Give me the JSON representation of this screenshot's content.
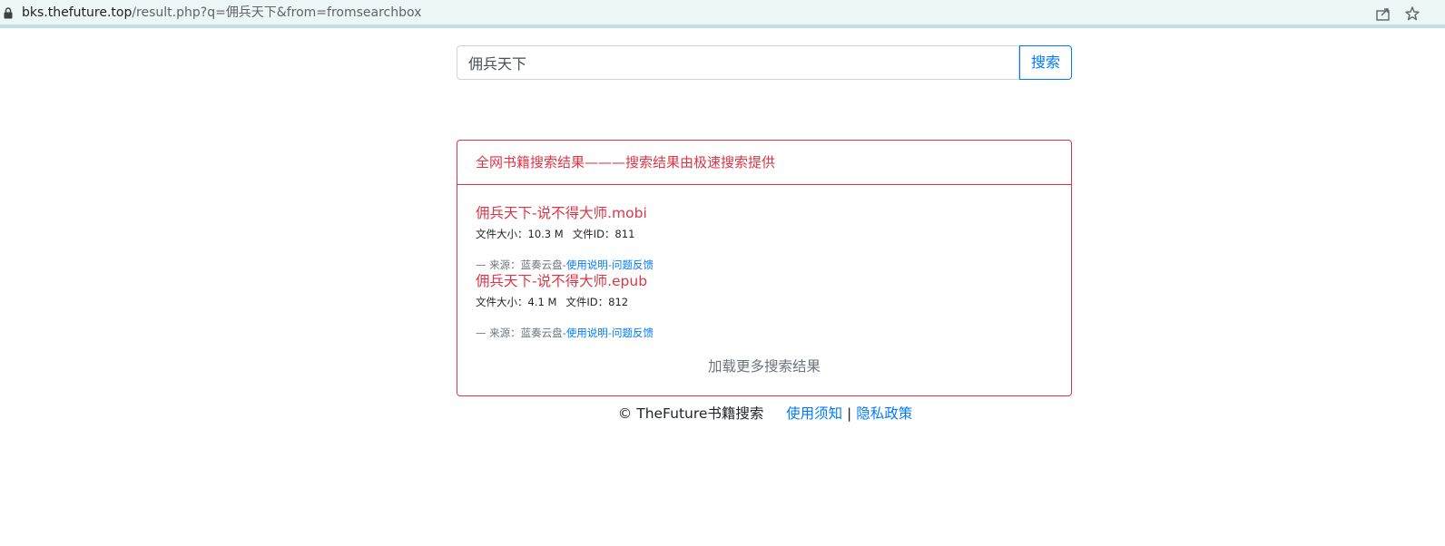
{
  "browser": {
    "url_host": "bks.thefuture.top",
    "url_rest": "/result.php?q=佣兵天下&from=fromsearchbox",
    "icons": [
      "lock-icon",
      "share-icon",
      "bookmark-star-icon"
    ]
  },
  "search": {
    "value": "佣兵天下",
    "button_label": "搜索"
  },
  "results_card": {
    "header": "全网书籍搜索结果———搜索结果由极速搜索提供",
    "items": [
      {
        "title": "佣兵天下-说不得大师.mobi",
        "size": "文件大小：10.3 M",
        "file_id": "文件ID：811",
        "source_prefix": "— 来源：蓝奏云盘-",
        "usage_link": "使用说明",
        "dash": "-",
        "feedback_link": "问题反馈"
      },
      {
        "title": "佣兵天下-说不得大师.epub",
        "size": "文件大小：4.1 M",
        "file_id": "文件ID：812",
        "source_prefix": "— 来源：蓝奏云盘-",
        "usage_link": "使用说明",
        "dash": "-",
        "feedback_link": "问题反馈"
      }
    ],
    "load_more": "加载更多搜索结果"
  },
  "footer": {
    "copyright": "© TheFuture书籍搜索",
    "terms_link": "使用须知",
    "separator": "|",
    "privacy_link": "隐私政策"
  },
  "colors": {
    "accent_red": "#dc3545",
    "link_blue": "#007bff",
    "addressbar_bg": "#ecf6f7"
  }
}
